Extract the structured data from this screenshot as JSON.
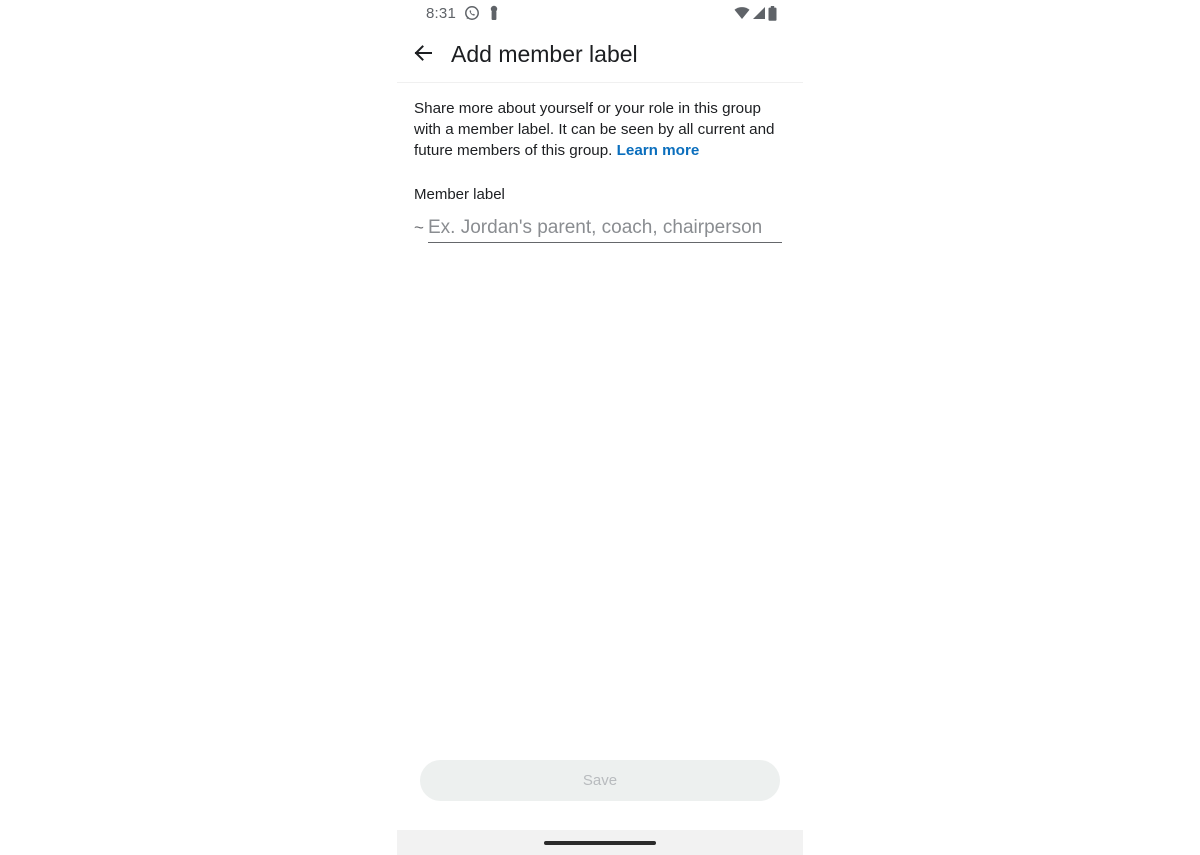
{
  "status_bar": {
    "time": "8:31"
  },
  "app_bar": {
    "title": "Add member label"
  },
  "description": {
    "text": "Share more about yourself or your role in this group with a member label. It can be seen by all current and future members of this group. ",
    "link": "Learn more"
  },
  "field": {
    "label": "Member label",
    "prefix": "~",
    "value": "",
    "placeholder": "Ex. Jordan's parent, coach, chairperson"
  },
  "save_button": {
    "label": "Save"
  },
  "colors": {
    "link": "#0a6ebd",
    "button_bg": "#edf0ef",
    "button_text": "#b8bbbe",
    "nav_bar": "#f2f2f2"
  }
}
